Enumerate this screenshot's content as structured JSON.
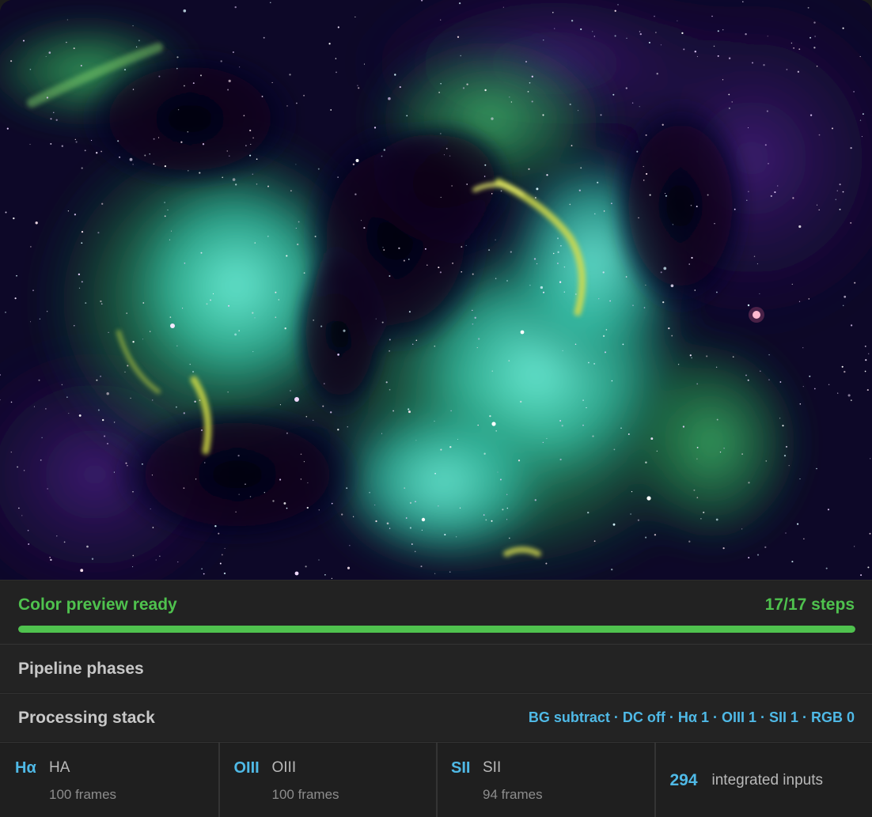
{
  "preview": {
    "colors": {
      "background": "#0d0828",
      "gas_teal": "#3fd3b8",
      "gas_green": "#2f9c5a",
      "rim_yellow": "#c8d24a",
      "dust_dark": "#070414",
      "purple_haze": "#3a1a63"
    }
  },
  "status": {
    "text": "Color preview ready",
    "steps": "17/17 steps",
    "progress_fraction": 1.0,
    "color": "#4fc24e"
  },
  "pipeline": {
    "title": "Pipeline phases"
  },
  "stack": {
    "title": "Processing stack",
    "summary": "BG subtract · DC off · Hα 1 · OIII 1 · SII 1 · RGB 0"
  },
  "channels": [
    {
      "symbol": "Hα",
      "name": "HA",
      "frames": "100 frames"
    },
    {
      "symbol": "OIII",
      "name": "OIII",
      "frames": "100 frames"
    },
    {
      "symbol": "SII",
      "name": "SII",
      "frames": "94 frames"
    }
  ],
  "totals": {
    "count": "294",
    "label": "integrated inputs"
  },
  "accent": "#4fb9e6"
}
